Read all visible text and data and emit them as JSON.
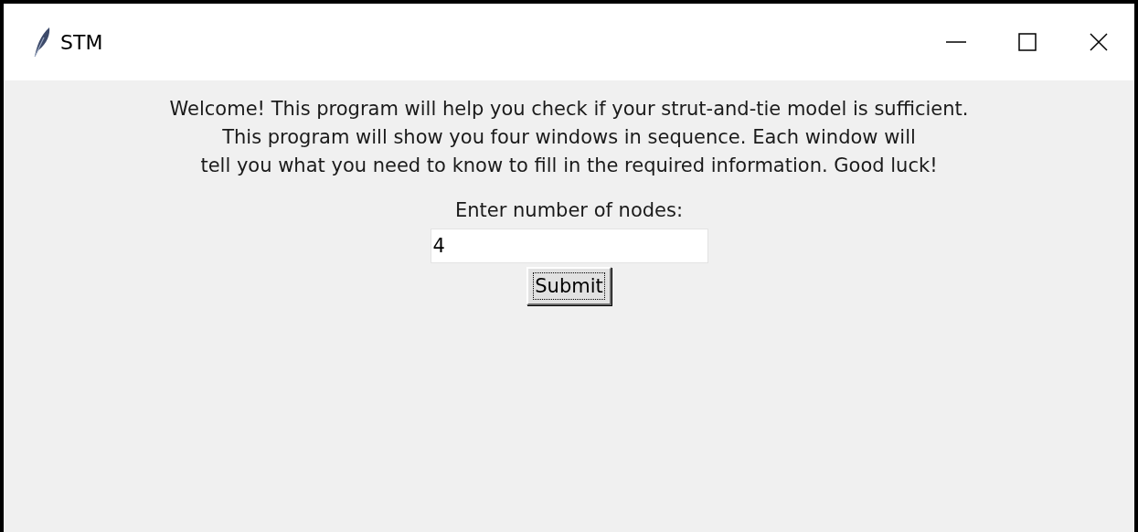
{
  "window": {
    "title": "STM"
  },
  "intro": [
    "Welcome! This program will help you check if your strut-and-tie model is sufficient.",
    "This program will show you four windows in sequence. Each window will",
    "tell you what you need to know to fill in the required information. Good luck!"
  ],
  "field": {
    "label": "Enter number of nodes:",
    "value": "4"
  },
  "submit": {
    "label": "Submit",
    "focused": true
  }
}
